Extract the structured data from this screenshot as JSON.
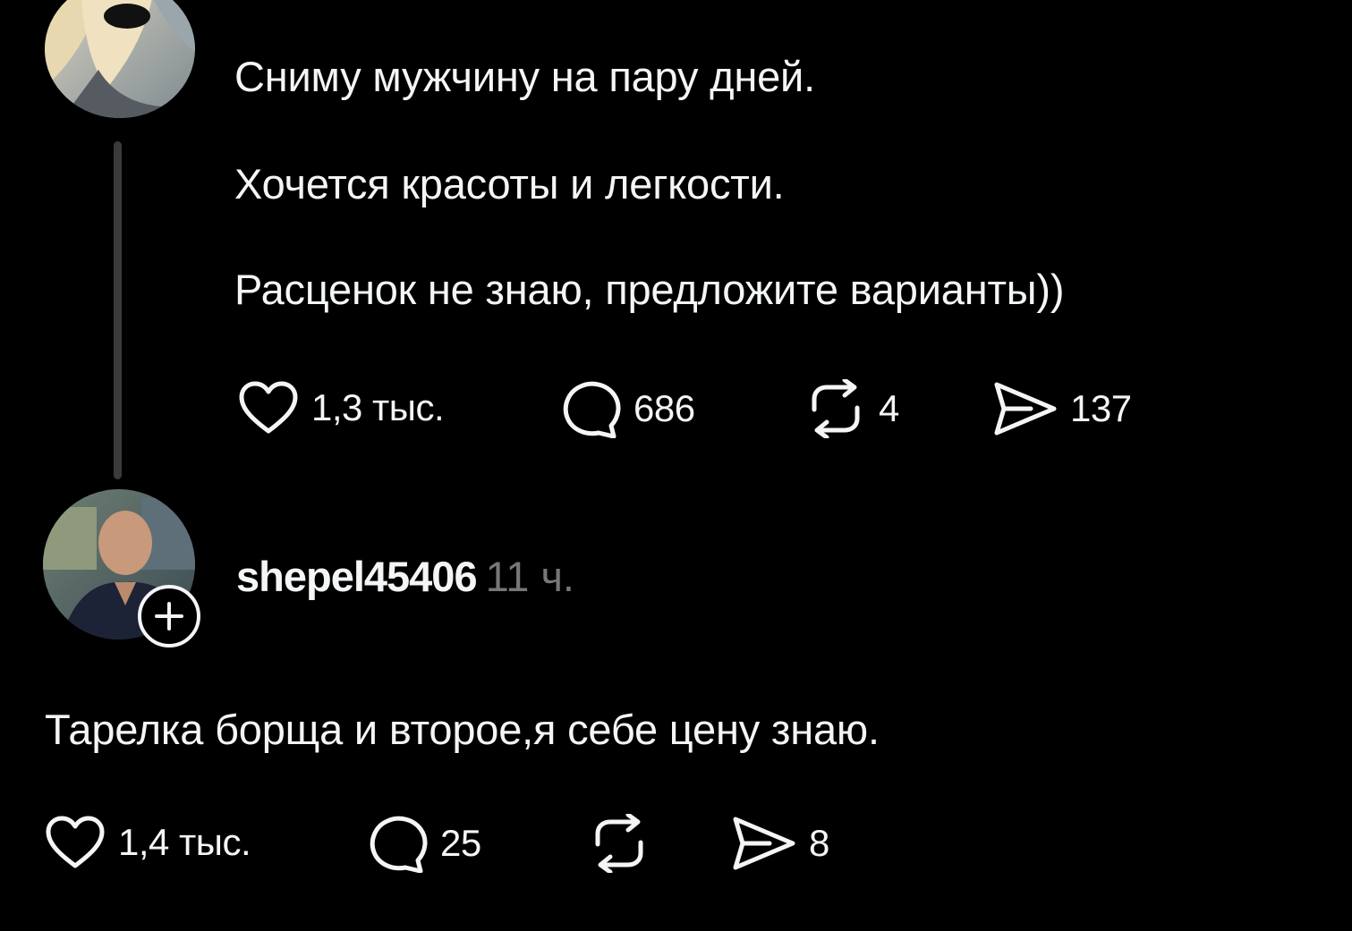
{
  "post": {
    "avatar_icon": "user-avatar",
    "lines": [
      "Сниму мужчину на пару дней.",
      "Хочется красоты и легкости.",
      "Расценок не знаю, предложите варианты))"
    ],
    "actions": {
      "like_count": "1,3 тыс.",
      "reply_count": "686",
      "repost_count": "4",
      "share_count": "137"
    }
  },
  "reply": {
    "avatar_icon": "user-avatar",
    "username": "shepel45406",
    "time": "11 ч.",
    "text": "Тарелка борща и второе,я себе цену знаю.",
    "actions": {
      "like_count": "1,4 тыс.",
      "reply_count": "25",
      "repost_count": "",
      "share_count": "8"
    }
  },
  "colors": {
    "background": "#000000",
    "text": "#f3f5f7",
    "muted": "#777777",
    "thread_line": "#3a3a3a"
  }
}
